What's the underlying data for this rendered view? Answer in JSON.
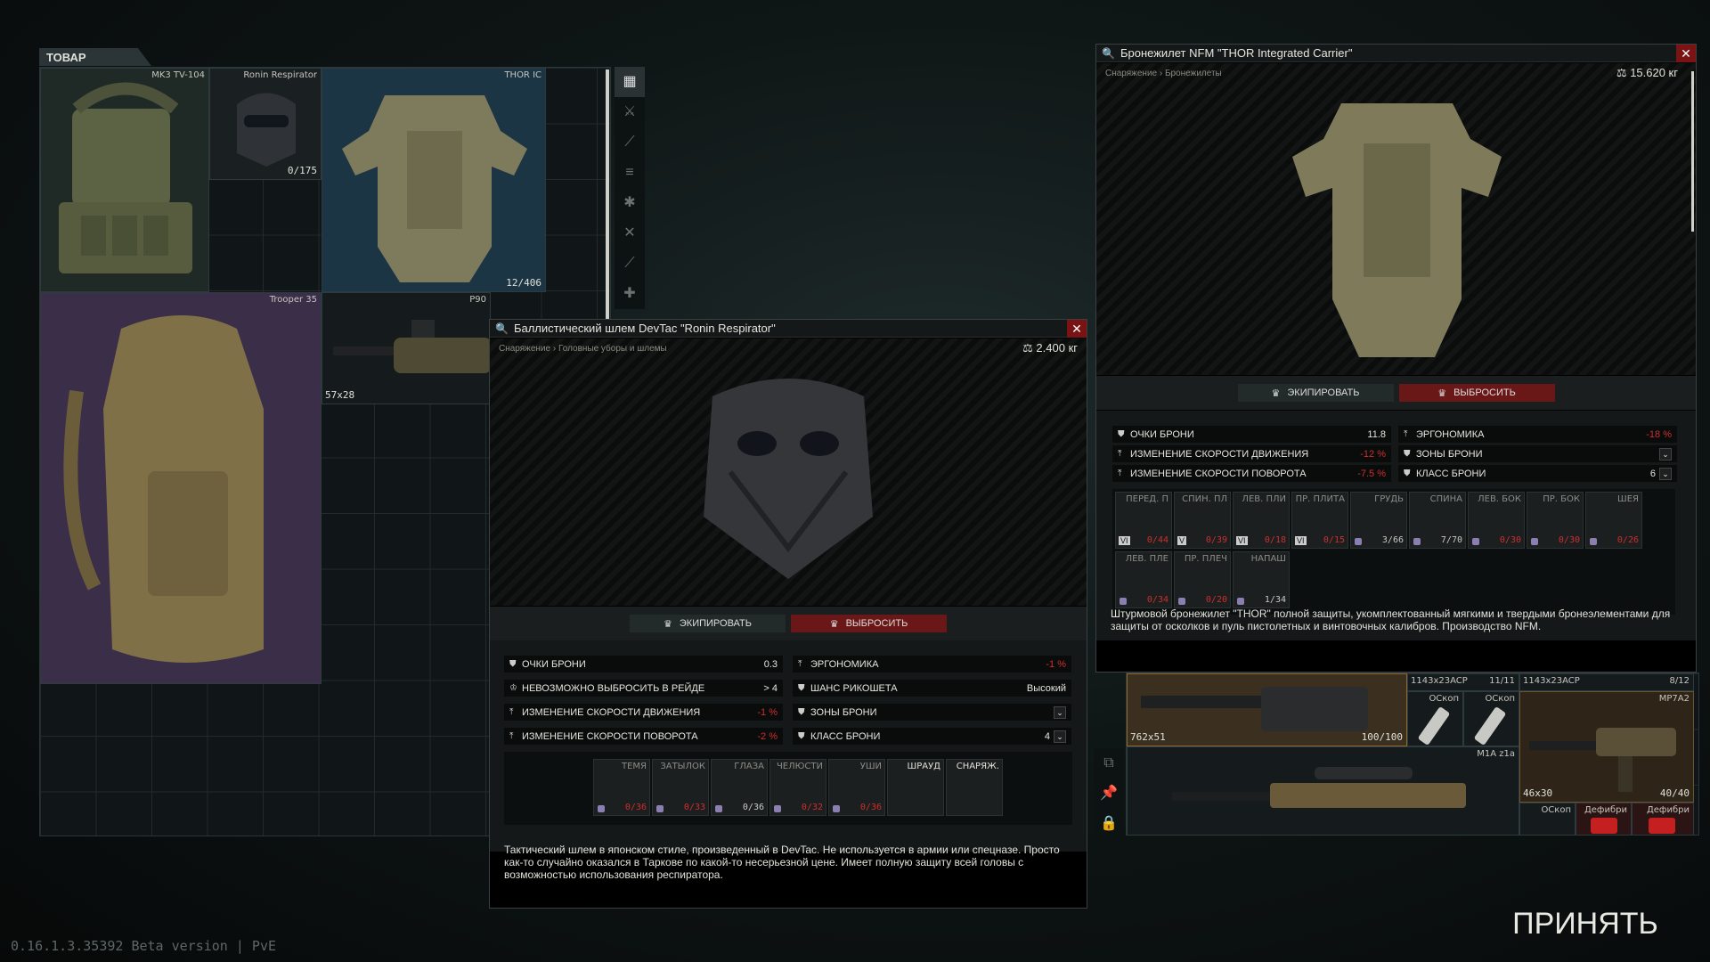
{
  "version": "0.16.1.3.35392 Beta version | PvE",
  "accept_label": "ПРИНЯТЬ",
  "goods": {
    "tab_label": "ТОВАР",
    "items": [
      {
        "name": "MK3 TV-104"
      },
      {
        "name": "Ronin Respirator",
        "count": "0/175"
      },
      {
        "name": "THOR IC",
        "count": "12/406"
      },
      {
        "name": "Trooper 35"
      },
      {
        "name": "P90",
        "caliber": "57x28"
      }
    ]
  },
  "helmet_window": {
    "title": "Баллистический шлем DevTac \"Ronin Respirator\"",
    "breadcrumb": "Снаряжение › Головные уборы и шлемы",
    "weight": "2.400 кг",
    "equip_label": "ЭКИПИРОВАТЬ",
    "drop_label": "ВЫБРОСИТЬ",
    "stats_left": [
      {
        "label": "ОЧКИ БРОНИ",
        "value": "0.3",
        "neg": false
      },
      {
        "label": "НЕВОЗМОЖНО ВЫБРОСИТЬ В РЕЙДЕ",
        "value": "> 4",
        "neg": false
      },
      {
        "label": "ИЗМЕНЕНИЕ СКОРОСТИ ДВИЖЕНИЯ",
        "value": "-1 %",
        "neg": true
      },
      {
        "label": "ИЗМЕНЕНИЕ СКОРОСТИ ПОВОРОТА",
        "value": "-2 %",
        "neg": true
      }
    ],
    "stats_right": [
      {
        "label": "ЭРГОНОМИКА",
        "value": "-1 %",
        "neg": true
      },
      {
        "label": "ШАНС РИКОШЕТА",
        "value": "Высокий",
        "neg": false
      },
      {
        "label": "ЗОНЫ БРОНИ",
        "value": "",
        "neg": false
      },
      {
        "label": "КЛАСС БРОНИ",
        "value": "4",
        "neg": false
      }
    ],
    "slots": [
      {
        "name": "ТЕМЯ",
        "value": "0/36",
        "neg": true
      },
      {
        "name": "ЗАТЫЛОК",
        "value": "0/33",
        "neg": true
      },
      {
        "name": "ГЛАЗА",
        "value": "0/36",
        "neg": false
      },
      {
        "name": "ЧЕЛЮСТИ",
        "value": "0/32",
        "neg": true
      },
      {
        "name": "УШИ",
        "value": "0/36",
        "neg": true
      },
      {
        "name": "ШРАУД",
        "value": "",
        "neg": false
      },
      {
        "name": "СНАРЯЖ.",
        "value": "",
        "neg": false
      }
    ],
    "description": "Тактический шлем в японском стиле, произведенный в DevTac. Не используется в армии или спецназе. Просто как-то случайно оказался в Таркове по какой-то несерьезной цене. Имеет полную защиту всей головы с возможностью использования респиратора."
  },
  "vest_window": {
    "title": "Бронежилет NFM \"THOR Integrated Carrier\"",
    "breadcrumb": "Снаряжение › Бронежилеты",
    "weight": "15.620 кг",
    "equip_label": "ЭКИПИРОВАТЬ",
    "drop_label": "ВЫБРОСИТЬ",
    "stats_left": [
      {
        "label": "ОЧКИ БРОНИ",
        "value": "11.8",
        "neg": false
      },
      {
        "label": "ИЗМЕНЕНИЕ СКОРОСТИ ДВИЖЕНИЯ",
        "value": "-12 %",
        "neg": true
      },
      {
        "label": "ИЗМЕНЕНИЕ СКОРОСТИ ПОВОРОТА",
        "value": "-7.5 %",
        "neg": true
      }
    ],
    "stats_right": [
      {
        "label": "ЭРГОНОМИКА",
        "value": "-18 %",
        "neg": true
      },
      {
        "label": "ЗОНЫ БРОНИ",
        "value": "",
        "neg": false
      },
      {
        "label": "КЛАСС БРОНИ",
        "value": "6",
        "neg": false
      }
    ],
    "slots": [
      {
        "name": "ПЕРЕД. П",
        "value": "0/44",
        "neg": true,
        "badge": "VI"
      },
      {
        "name": "СПИН. ПЛ",
        "value": "0/39",
        "neg": true,
        "badge": "V"
      },
      {
        "name": "ЛЕВ. ПЛИ",
        "value": "0/18",
        "neg": true,
        "badge": "VI"
      },
      {
        "name": "ПР. ПЛИТА",
        "value": "0/15",
        "neg": true,
        "badge": "VI"
      },
      {
        "name": "ГРУДЬ",
        "value": "3/66",
        "neg": false,
        "badge": ""
      },
      {
        "name": "СПИНА",
        "value": "7/70",
        "neg": false,
        "badge": ""
      },
      {
        "name": "ЛЕВ. БОК",
        "value": "0/30",
        "neg": true,
        "badge": ""
      },
      {
        "name": "ПР. БОК",
        "value": "0/30",
        "neg": true,
        "badge": ""
      },
      {
        "name": "ШЕЯ",
        "value": "0/26",
        "neg": true,
        "badge": ""
      },
      {
        "name": "ЛЕВ. ПЛЕ",
        "value": "0/34",
        "neg": true,
        "badge": ""
      },
      {
        "name": "ПР. ПЛЕЧ",
        "value": "0/20",
        "neg": true,
        "badge": ""
      },
      {
        "name": "НАПАШ",
        "value": "1/34",
        "neg": false,
        "badge": ""
      }
    ],
    "description": "Штурмовой бронежилет \"THOR\" полной защиты, укомплектованный мягкими и твердыми бронеэлементами для защиты от осколков и пуль пистолетных и винтовочных калибров. Производство NFM."
  },
  "stash": {
    "items": [
      {
        "name": "",
        "caliber": "762x51",
        "count": "100/100"
      },
      {
        "name": "1143x23ACP",
        "count": "11/11"
      },
      {
        "name": "ОСкоп"
      },
      {
        "name": "ОСкоп"
      },
      {
        "name": "1143x23ACP",
        "count": "8/12"
      },
      {
        "name": "MP7A2",
        "caliber": "46x30",
        "count": "40/40"
      },
      {
        "name": "M1A z1a"
      },
      {
        "name": "ОСкоп"
      },
      {
        "name": "Дефибри"
      },
      {
        "name": "Дефибри"
      }
    ]
  }
}
